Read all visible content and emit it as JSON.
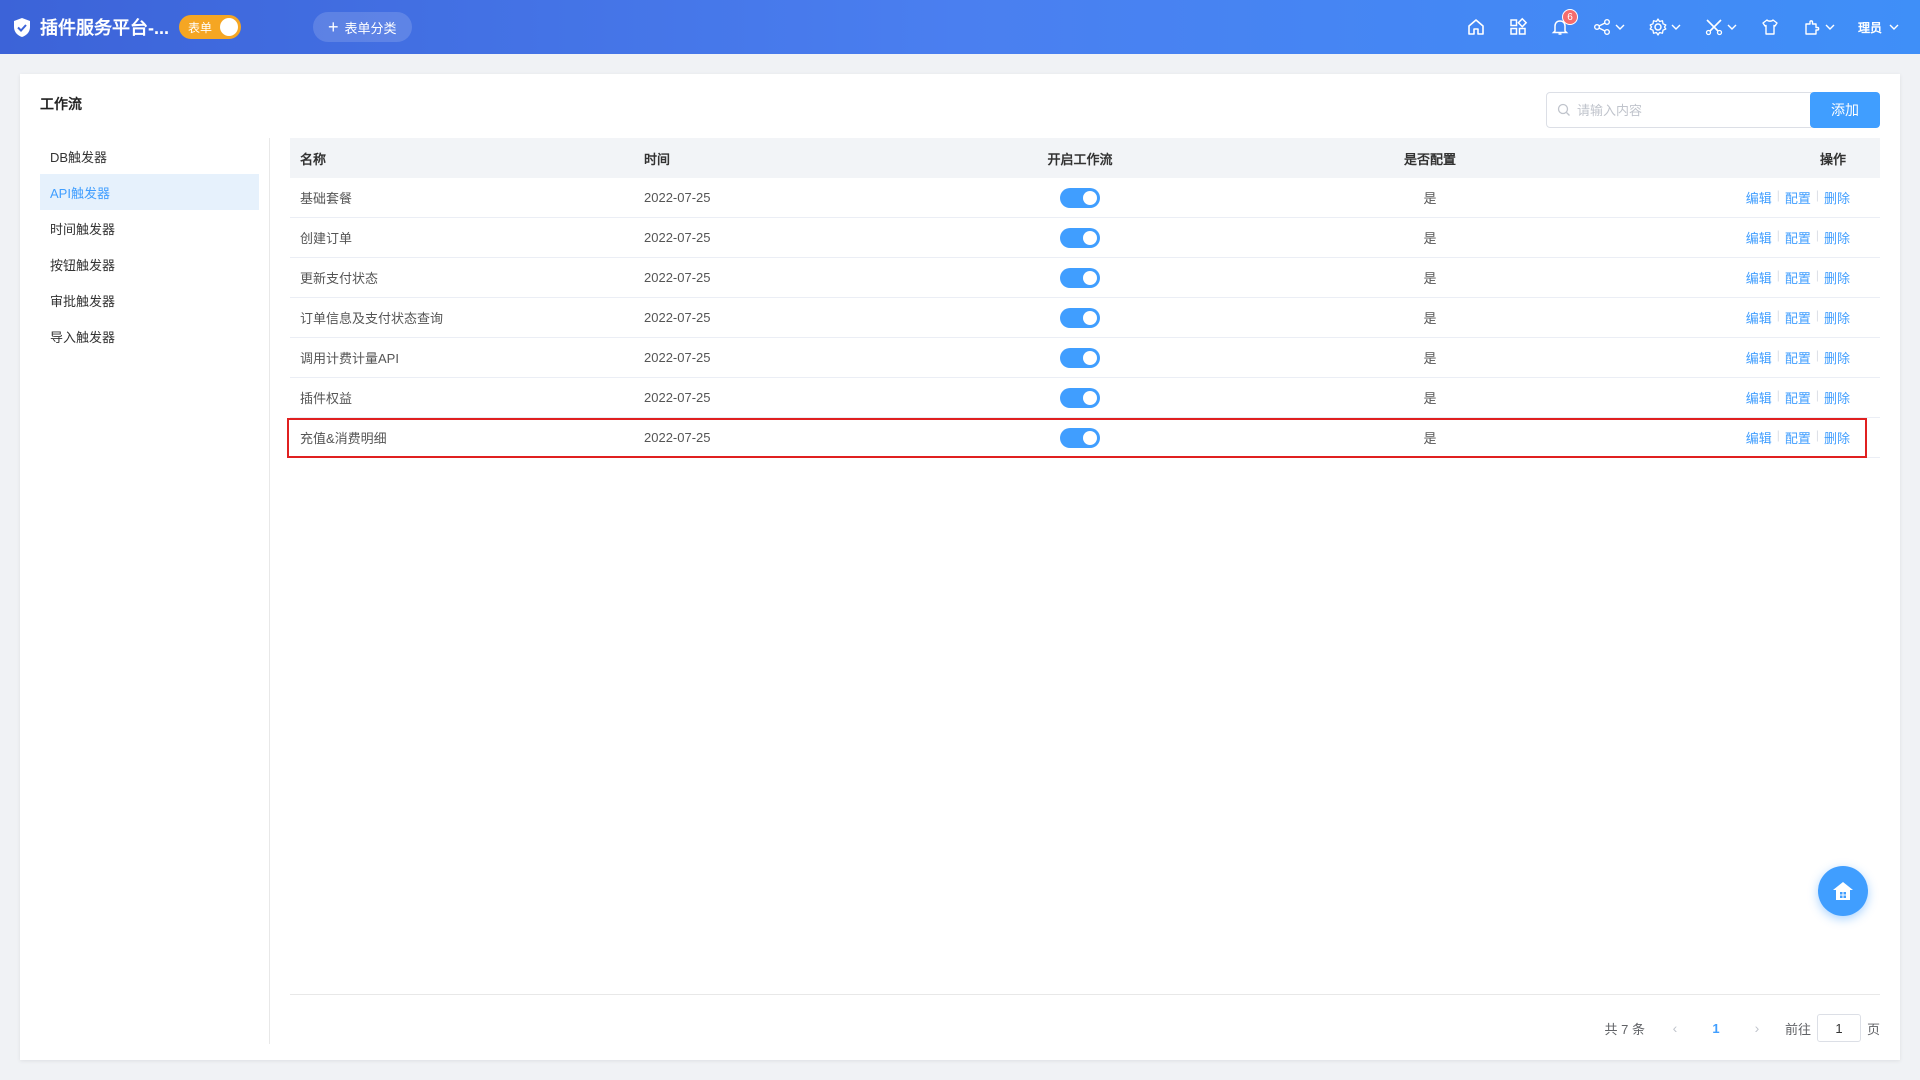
{
  "header": {
    "app_title": "插件服务平台-...",
    "mode_toggle_label": "表单",
    "add_category_label": "表单分类",
    "notification_count": "6",
    "user_name": "理员"
  },
  "card": {
    "title": "工作流",
    "search_placeholder": "请输入内容",
    "add_button_label": "添加"
  },
  "sidebar": {
    "items": [
      {
        "label": "DB触发器"
      },
      {
        "label": "API触发器"
      },
      {
        "label": "时间触发器"
      },
      {
        "label": "按钮触发器"
      },
      {
        "label": "审批触发器"
      },
      {
        "label": "导入触发器"
      }
    ],
    "active_index": 1
  },
  "table": {
    "columns": {
      "name": "名称",
      "time": "时间",
      "enabled": "开启工作流",
      "configured": "是否配置",
      "actions": "操作"
    },
    "action_labels": {
      "edit": "编辑",
      "config": "配置",
      "delete": "删除",
      "separator": "|"
    },
    "rows": [
      {
        "name": "基础套餐",
        "time": "2022-07-25",
        "enabled": true,
        "configured": "是"
      },
      {
        "name": "创建订单",
        "time": "2022-07-25",
        "enabled": true,
        "configured": "是"
      },
      {
        "name": "更新支付状态",
        "time": "2022-07-25",
        "enabled": true,
        "configured": "是"
      },
      {
        "name": "订单信息及支付状态查询",
        "time": "2022-07-25",
        "enabled": true,
        "configured": "是"
      },
      {
        "name": "调用计费计量API",
        "time": "2022-07-25",
        "enabled": true,
        "configured": "是"
      },
      {
        "name": "插件权益",
        "time": "2022-07-25",
        "enabled": true,
        "configured": "是"
      },
      {
        "name": "充值&消费明细",
        "time": "2022-07-25",
        "enabled": true,
        "configured": "是"
      }
    ],
    "highlighted_row_index": 6
  },
  "pagination": {
    "total_label": "共 7 条",
    "current_page": "1",
    "goto_label": "前往",
    "goto_value": "1",
    "page_suffix": "页"
  },
  "colors": {
    "header_gradient_start": "#3c63d8",
    "header_gradient_end": "#3f8ff8",
    "accent": "#409eff",
    "toggle_orange": "#f5a623",
    "highlight_border": "#e02020",
    "badge_red": "#f56c6c"
  },
  "icons": {
    "brand": "shield-check-icon",
    "header": [
      "home-icon",
      "apps-grid-icon",
      "bell-icon",
      "share-icon",
      "gear-icon",
      "tools-icon",
      "shirt-icon",
      "plugin-icon"
    ],
    "fab": "home-icon"
  }
}
